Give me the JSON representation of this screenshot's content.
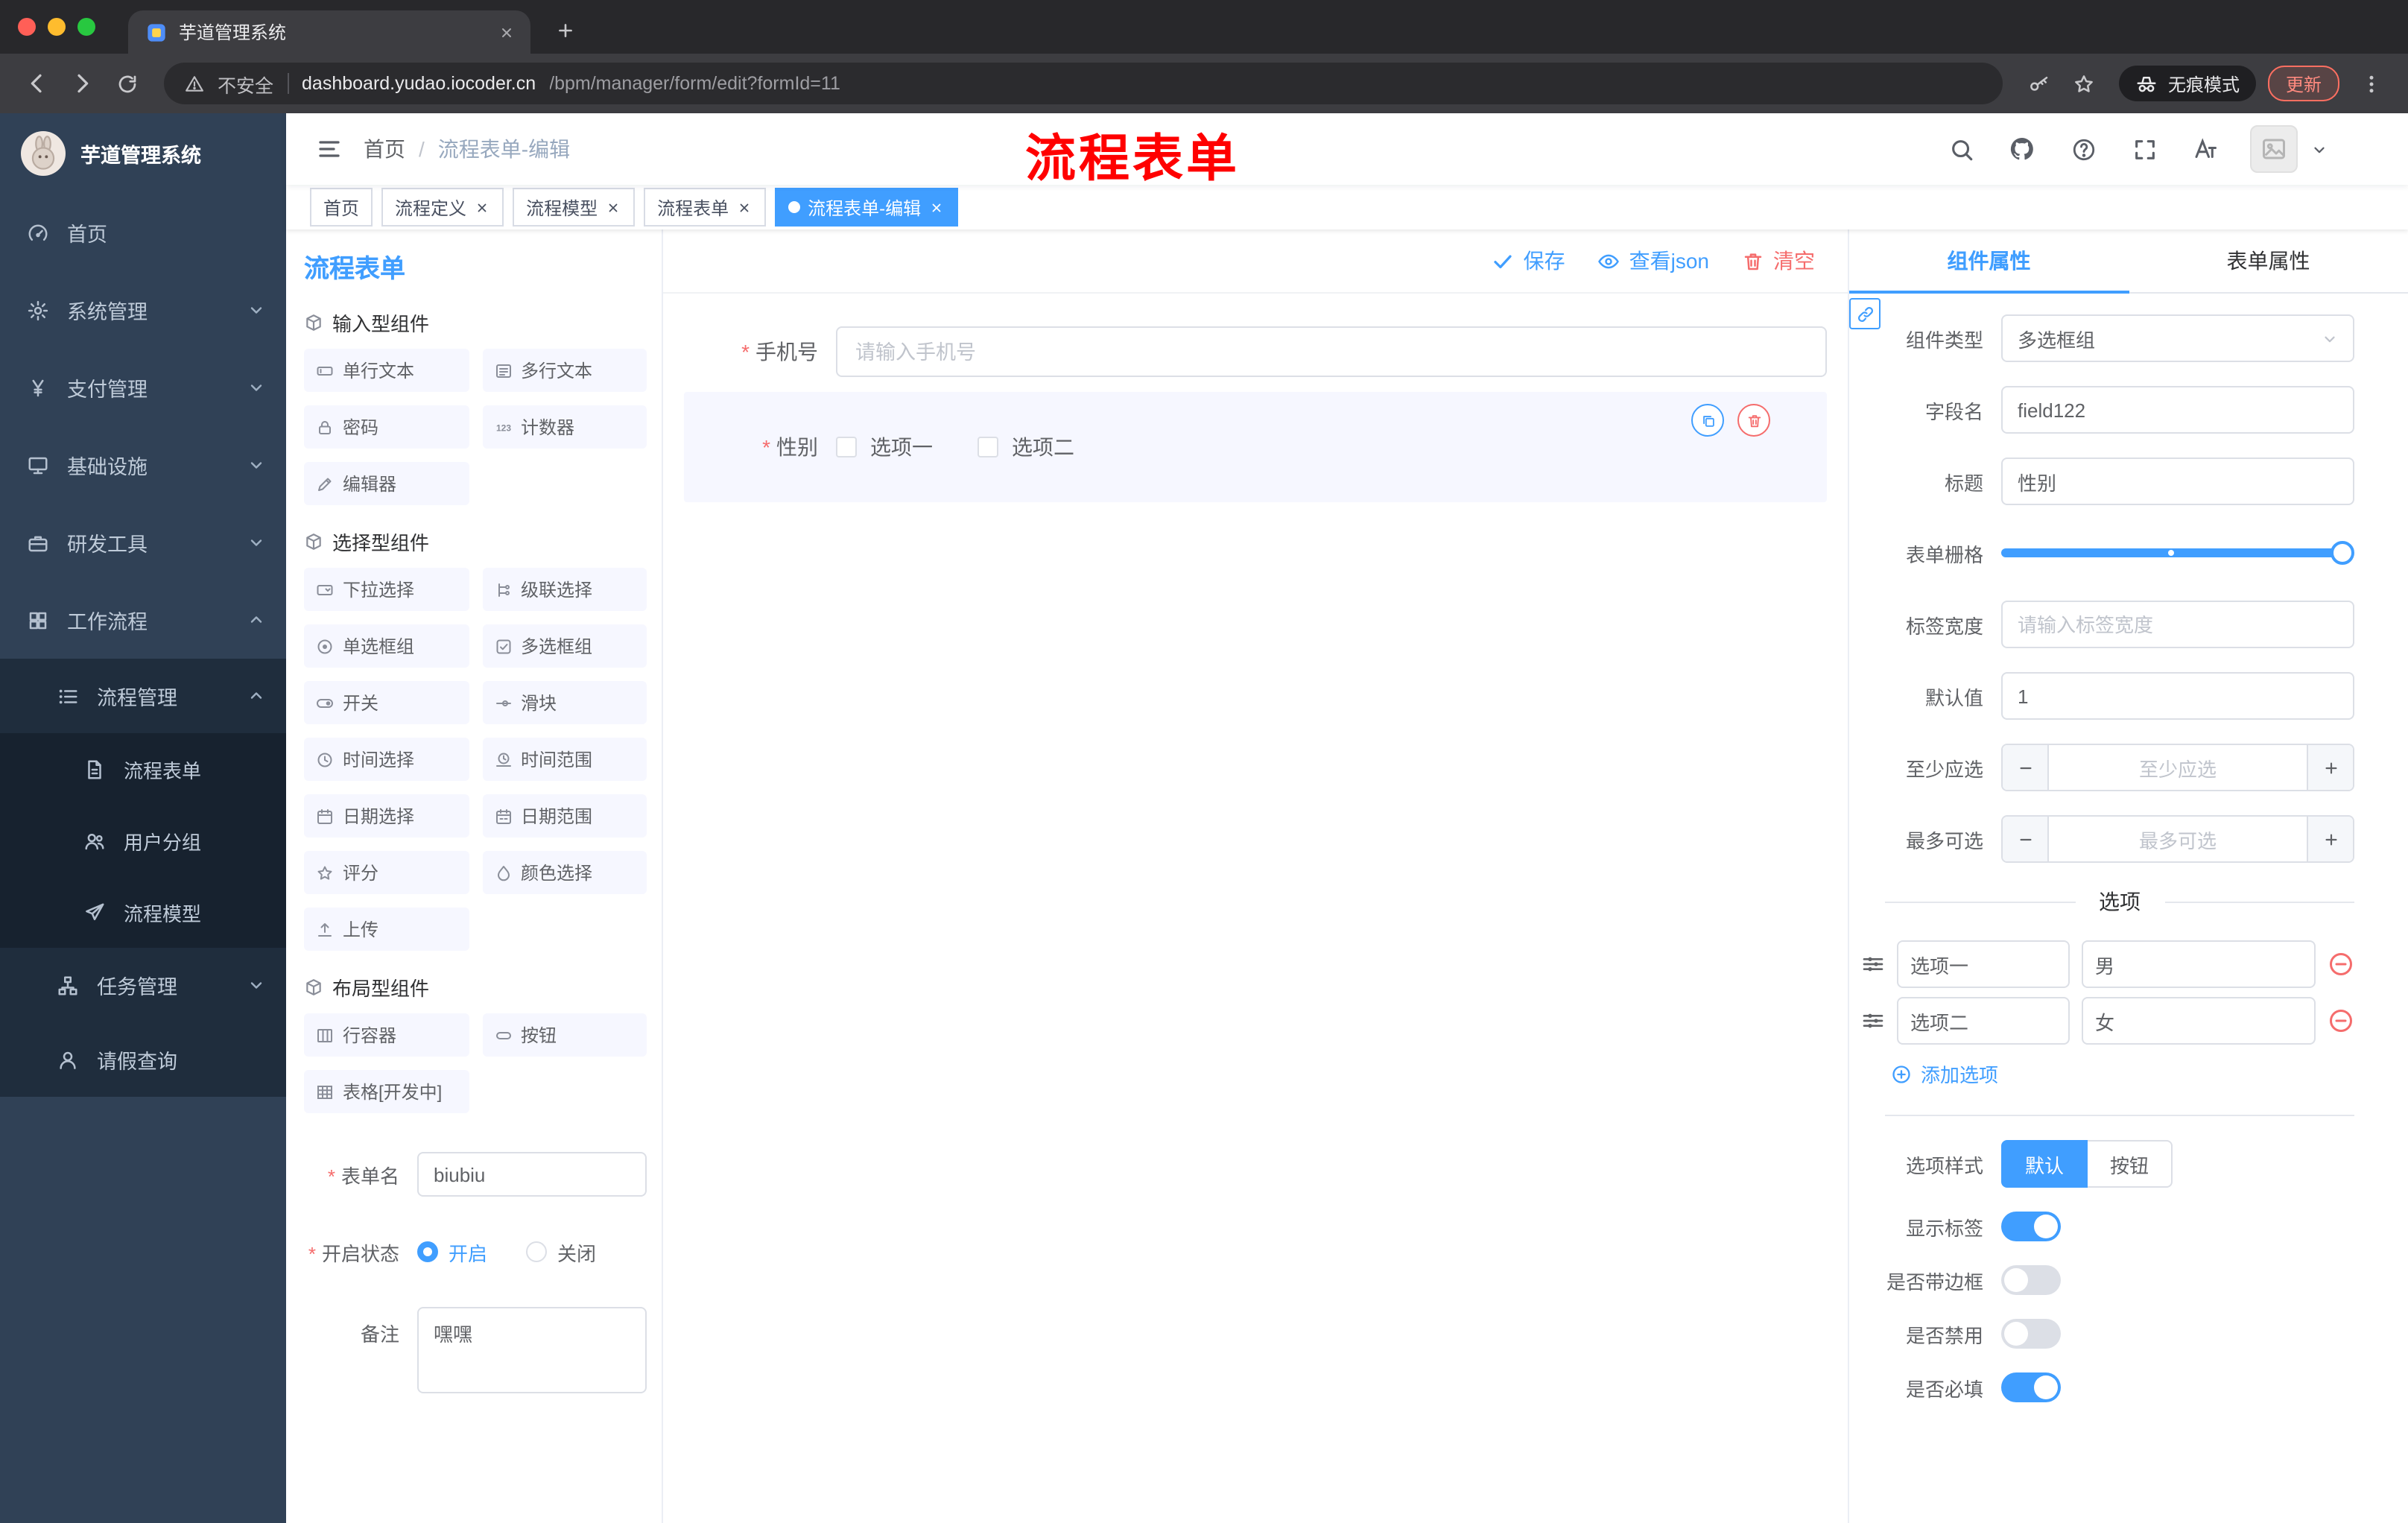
{
  "browser": {
    "tab_title": "芋道管理系统",
    "security_label": "不安全",
    "url_host": "dashboard.yudao.iocoder.cn",
    "url_path": "/bpm/manager/form/edit?formId=11",
    "incognito_label": "无痕模式",
    "update_label": "更新"
  },
  "annotation": {
    "text": "流程表单"
  },
  "sidebar": {
    "logo_title": "芋道管理系统",
    "items": [
      {
        "label": "首页"
      },
      {
        "label": "系统管理"
      },
      {
        "label": "支付管理"
      },
      {
        "label": "基础设施"
      },
      {
        "label": "研发工具"
      },
      {
        "label": "工作流程"
      },
      {
        "label": "流程管理"
      },
      {
        "label": "流程表单"
      },
      {
        "label": "用户分组"
      },
      {
        "label": "流程模型"
      },
      {
        "label": "任务管理"
      },
      {
        "label": "请假查询"
      }
    ]
  },
  "navbar": {
    "breadcrumb_home": "首页",
    "breadcrumb_sep": "/",
    "breadcrumb_current": "流程表单-编辑"
  },
  "tags": [
    {
      "label": "首页"
    },
    {
      "label": "流程定义"
    },
    {
      "label": "流程模型"
    },
    {
      "label": "流程表单"
    },
    {
      "label": "流程表单-编辑"
    }
  ],
  "designer": {
    "title": "流程表单",
    "actions": {
      "save": "保存",
      "view_json": "查看json",
      "clear": "清空"
    },
    "palette": {
      "section1": "输入型组件",
      "section2": "选择型组件",
      "section3": "布局型组件",
      "input_items": [
        "单行文本",
        "多行文本",
        "密码",
        "计数器",
        "编辑器"
      ],
      "select_items": [
        "下拉选择",
        "级联选择",
        "单选框组",
        "多选框组",
        "开关",
        "滑块",
        "时间选择",
        "时间范围",
        "日期选择",
        "日期范围",
        "评分",
        "颜色选择",
        "上传"
      ],
      "layout_items": [
        "行容器",
        "按钮",
        "表格[开发中]"
      ]
    },
    "meta": {
      "form_name_label": "表单名",
      "form_name_value": "biubiu",
      "status_label": "开启状态",
      "status_on": "开启",
      "status_off": "关闭",
      "remark_label": "备注",
      "remark_value": "嘿嘿"
    },
    "canvas": {
      "phone_label": "手机号",
      "phone_placeholder": "请输入手机号",
      "gender_label": "性别",
      "gender_options": [
        "选项一",
        "选项二"
      ]
    },
    "props": {
      "tab_component": "组件属性",
      "tab_form": "表单属性",
      "component_type_label": "组件类型",
      "component_type_value": "多选框组",
      "field_name_label": "字段名",
      "field_name_value": "field122",
      "title_label": "标题",
      "title_value": "性别",
      "grid_label": "表单栅格",
      "label_width_label": "标签宽度",
      "label_width_placeholder": "请输入标签宽度",
      "default_label": "默认值",
      "default_value": "1",
      "min_label": "至少应选",
      "min_placeholder": "至少应选",
      "max_label": "最多可选",
      "max_placeholder": "最多可选",
      "options_title": "选项",
      "options": [
        {
          "label": "选项一",
          "value": "男"
        },
        {
          "label": "选项二",
          "value": "女"
        }
      ],
      "add_option": "添加选项",
      "style_label": "选项样式",
      "style_default": "默认",
      "style_button": "按钮",
      "show_label_label": "显示标签",
      "border_label": "是否带边框",
      "disabled_label": "是否禁用",
      "required_label": "是否必填"
    }
  },
  "colors": {
    "accent": "#409eff",
    "danger": "#f56c6c",
    "annotation_red": "#ff0000",
    "sidebar_bg": "#304156",
    "sidebar_sub_bg": "#1f2d3d"
  }
}
